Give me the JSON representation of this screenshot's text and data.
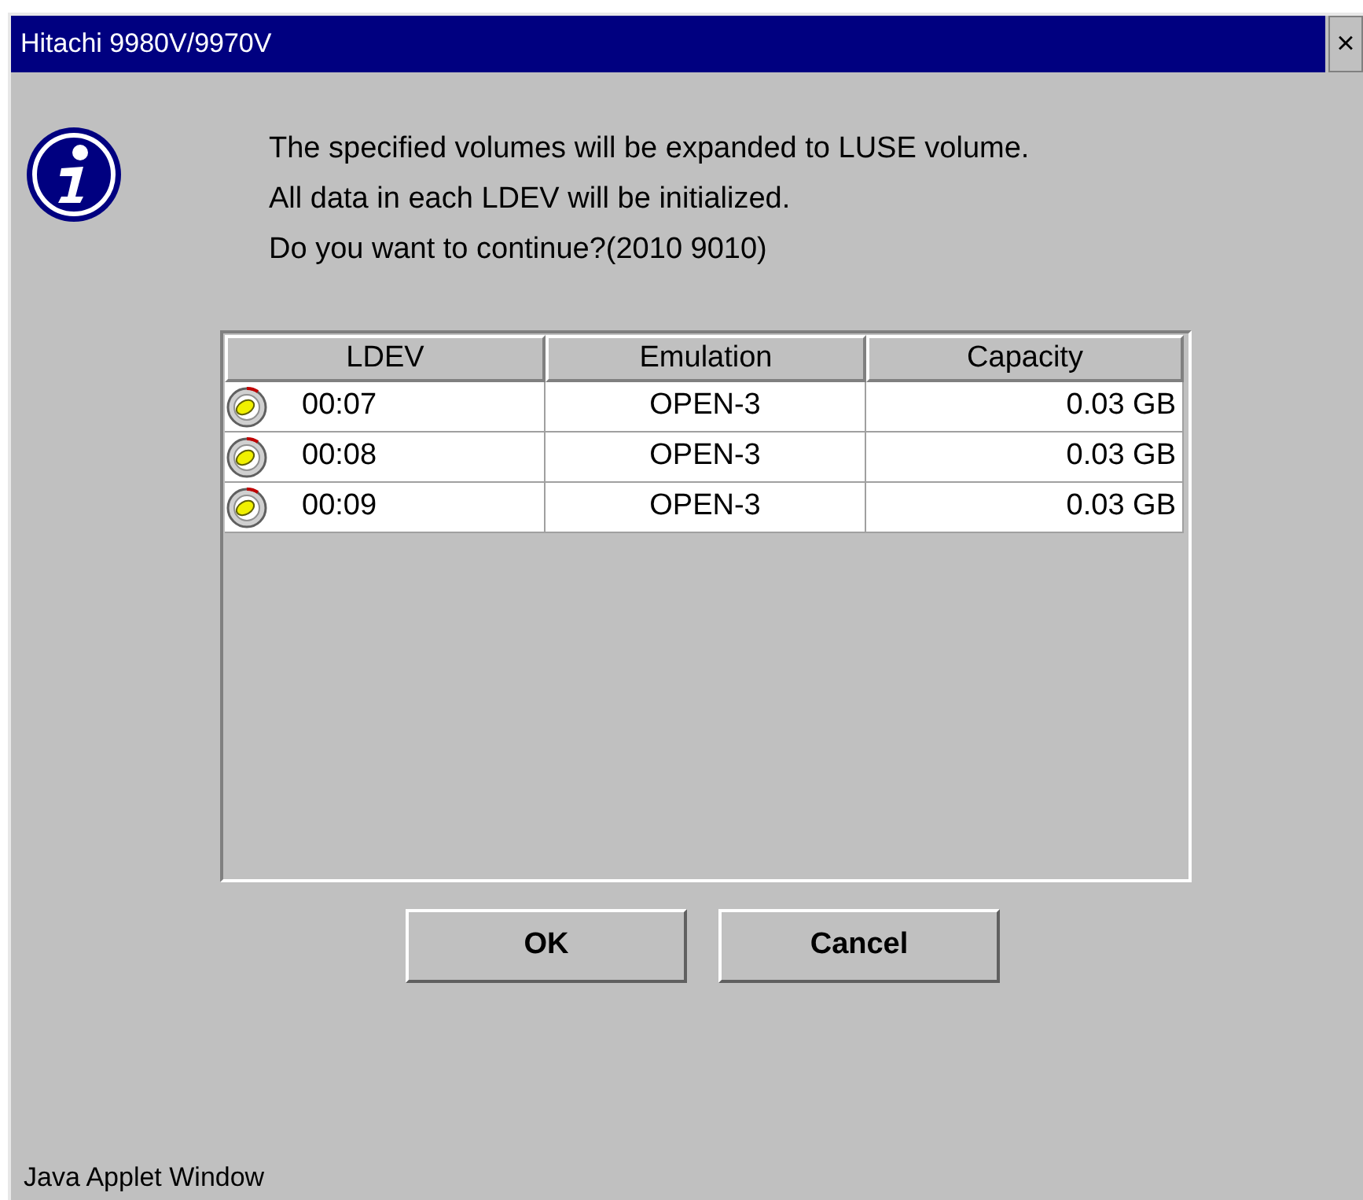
{
  "window": {
    "title": "Hitachi 9980V/9970V",
    "close": "×"
  },
  "message": [
    "The specified volumes will be expanded to LUSE volume.",
    "All data in each LDEV will be initialized.",
    "Do you want to continue?(2010 9010)"
  ],
  "table": {
    "columns": [
      "LDEV",
      "Emulation",
      "Capacity"
    ],
    "rows": [
      [
        "00:07",
        "OPEN-3",
        "0.03 GB"
      ],
      [
        "00:08",
        "OPEN-3",
        "0.03 GB"
      ],
      [
        "00:09",
        "OPEN-3",
        "0.03 GB"
      ]
    ]
  },
  "buttons": [
    "OK",
    "Cancel"
  ],
  "status_bar": "Java Applet Window"
}
